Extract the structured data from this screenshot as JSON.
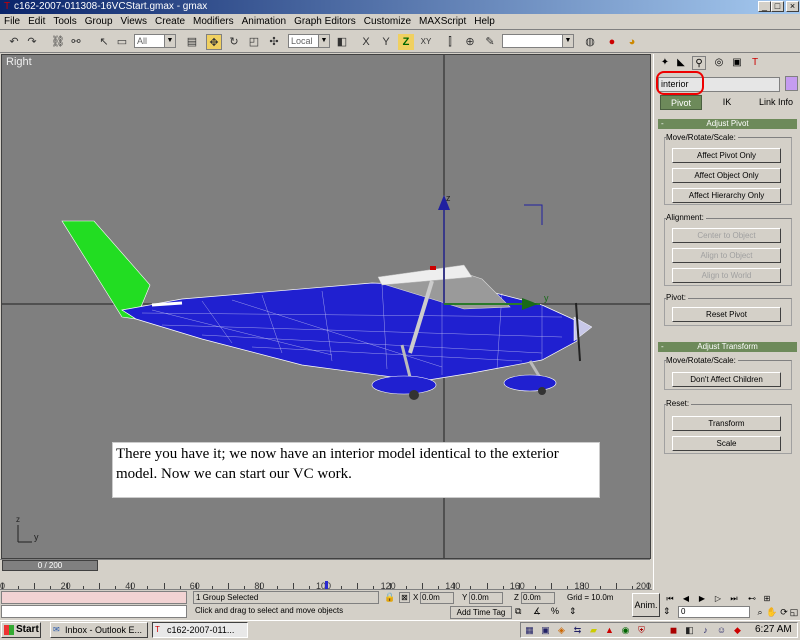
{
  "window": {
    "title": "c162-2007-011308-16VCStart.gmax - gmax",
    "minimize": "_",
    "maximize": "□",
    "close": "×"
  },
  "menu": [
    "File",
    "Edit",
    "Tools",
    "Group",
    "Views",
    "Create",
    "Modifiers",
    "Animation",
    "Graph Editors",
    "Customize",
    "MAXScript",
    "Help"
  ],
  "toolbar": {
    "selection_filter": "All",
    "ref_coord": "Local",
    "named_selection": "",
    "axis_x": "X",
    "axis_y": "Y",
    "axis_z": "Z",
    "axis_xy": "XY"
  },
  "viewport": {
    "label": "Right",
    "caption": "There you have it; we now have an interior model identical to the exterior model.  Now we can start our VC work.",
    "gizmo_z": "z",
    "gizmo_y": "y",
    "axis_y": "y",
    "axis_z": "z"
  },
  "command_panel": {
    "object_name": "interior",
    "object_color": "#c59cf0",
    "hierarchy_tabs": [
      "Pivot",
      "IK",
      "Link Info"
    ],
    "adjust_pivot": {
      "title": "Adjust Pivot",
      "move_rotate_scale_label": "Move/Rotate/Scale:",
      "buttons": [
        "Affect Pivot Only",
        "Affect Object Only",
        "Affect Hierarchy Only"
      ],
      "alignment_label": "Alignment:",
      "alignment_buttons": [
        "Center to Object",
        "Align to Object",
        "Align to World"
      ],
      "pivot_label": "Pivot:",
      "reset_pivot": "Reset Pivot"
    },
    "adjust_transform": {
      "title": "Adjust Transform",
      "move_rotate_scale_label": "Move/Rotate/Scale:",
      "dont_affect": "Don't Affect Children",
      "reset_label": "Reset:",
      "transform": "Transform",
      "scale": "Scale"
    }
  },
  "timeline": {
    "slider_label": "0 / 200",
    "current_frame": 0,
    "total_frames": 200,
    "ticks": [
      "0",
      "20",
      "40",
      "60",
      "80",
      "100",
      "120",
      "140",
      "160",
      "180",
      "200"
    ]
  },
  "status": {
    "selection": "1 Group Selected",
    "prompt": "Click and drag to select and move objects",
    "x_label": "X",
    "x": "0.0m",
    "y_label": "Y",
    "y": "0.0m",
    "z_label": "Z",
    "z": "0.0m",
    "grid": "Grid = 10.0m",
    "add_time_tag": "Add Time Tag",
    "anim": "Anim.",
    "frame": "0"
  },
  "taskbar": {
    "start": "Start",
    "tasks": [
      "Inbox - Outlook E...",
      "c162-2007-011..."
    ],
    "clock": "6:27 AM"
  },
  "colors": {
    "fuselage": "#2020d0",
    "tail": "#22dd22",
    "viewport_bg": "#7f7f7f",
    "panel_accent": "#6d8a5a"
  }
}
